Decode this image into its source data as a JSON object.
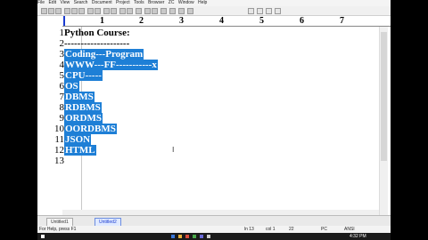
{
  "menu": [
    "File",
    "Edit",
    "View",
    "Search",
    "Document",
    "Project",
    "Tools",
    "Browser",
    "ZC",
    "Window",
    "Help"
  ],
  "ruler": [
    "1",
    "2",
    "3",
    "4",
    "5",
    "6",
    "7"
  ],
  "lines": [
    {
      "num": "1",
      "text": "Python Course:",
      "selected": false
    },
    {
      "num": "2",
      "text": "--------------------",
      "selected": false
    },
    {
      "num": "3",
      "text": "Coding---Program",
      "selected": true
    },
    {
      "num": "4",
      "text": "WWW---FF-----------x",
      "selected": true
    },
    {
      "num": "5",
      "text": "CPU-----",
      "selected": true
    },
    {
      "num": "6",
      "text": "OS",
      "selected": true
    },
    {
      "num": "7",
      "text": "DBMS",
      "selected": true
    },
    {
      "num": "8",
      "text": "RDBMS",
      "selected": true
    },
    {
      "num": "9",
      "text": "ORDMS",
      "selected": true
    },
    {
      "num": "10",
      "text": "OORDBMS",
      "selected": true
    },
    {
      "num": "11",
      "text": "JSON",
      "selected": true
    },
    {
      "num": "12",
      "text": "HTML",
      "selected": true
    },
    {
      "num": "13",
      "text": "",
      "selected": false
    }
  ],
  "tabs": [
    "Untitled1",
    "Untitled2"
  ],
  "status": {
    "help": "For Help, press F1",
    "ln": "ln 13",
    "col": "col 1",
    "s1": "22",
    "s2": "PC",
    "enc": "ANSI",
    "clock": "4:32 PM"
  },
  "colors": {
    "selection": "#1e7fd6",
    "ruler_marker": "#1a3bd0"
  }
}
